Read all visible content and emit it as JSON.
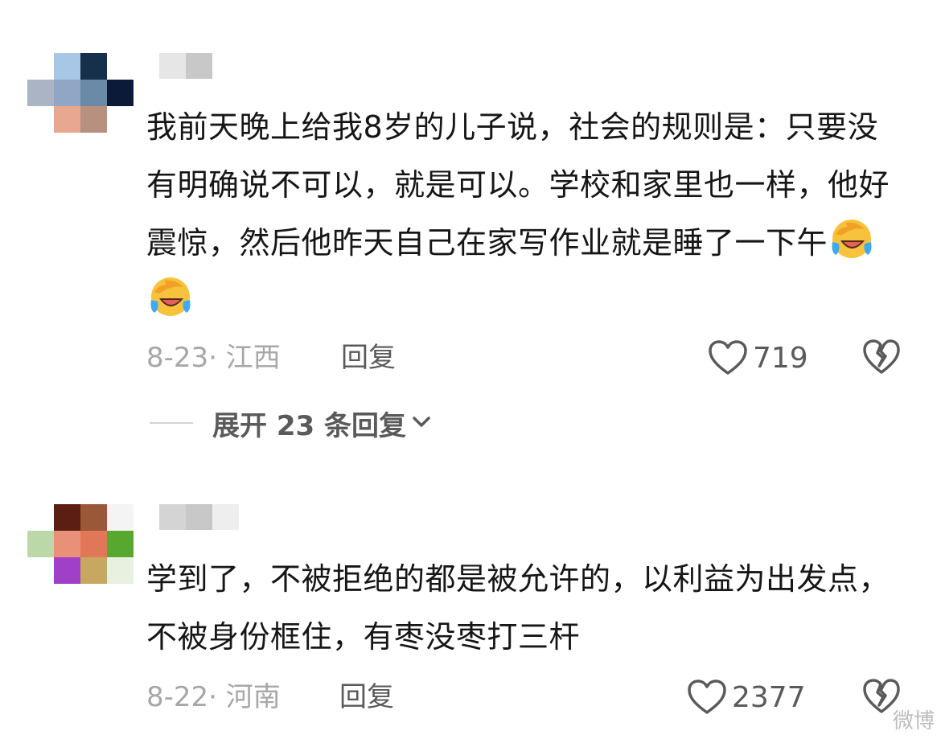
{
  "comments": [
    {
      "text": "我前天晚上给我8岁的儿子说，社会的规则是：只要没有明确说不可以，就是可以。学校和家里也一样，他好震惊，然后他昨天自己在家写作业就是睡了一下午",
      "emoji": [
        "crying-laughing-emoji",
        "crying-laughing-emoji"
      ],
      "date_location": "8-23· 江西",
      "reply_label": "回复",
      "likes": "719",
      "avatar_colors": [
        "#a8c6e6",
        "#16304c",
        "#ffffff",
        "#aab4c4",
        "#6a8aa8",
        "#0c1a3a",
        "#e8a890",
        "#b89080",
        "#ffffff"
      ],
      "username_colors": [
        "#e6e6e6",
        "#c8c8c8"
      ]
    },
    {
      "text": "学到了，不被拒绝的都是被允许的，以利益为出发点，不被身份框住，有枣没枣打三杆",
      "date_location": "8-22· 河南",
      "reply_label": "回复",
      "likes": "2377",
      "avatar_colors": [
        "#5a1e12",
        "#9a5838",
        "#eeeeee",
        "#e89078",
        "#e07858",
        "#58a830",
        "#a040c8",
        "#c8a860",
        "#e8f0e0"
      ],
      "username_colors": [
        "#d4d4d4",
        "#c8c8c8",
        "#eeeeee"
      ]
    }
  ],
  "expand_replies_label": "展开 23 条回复",
  "watermark": "微博"
}
